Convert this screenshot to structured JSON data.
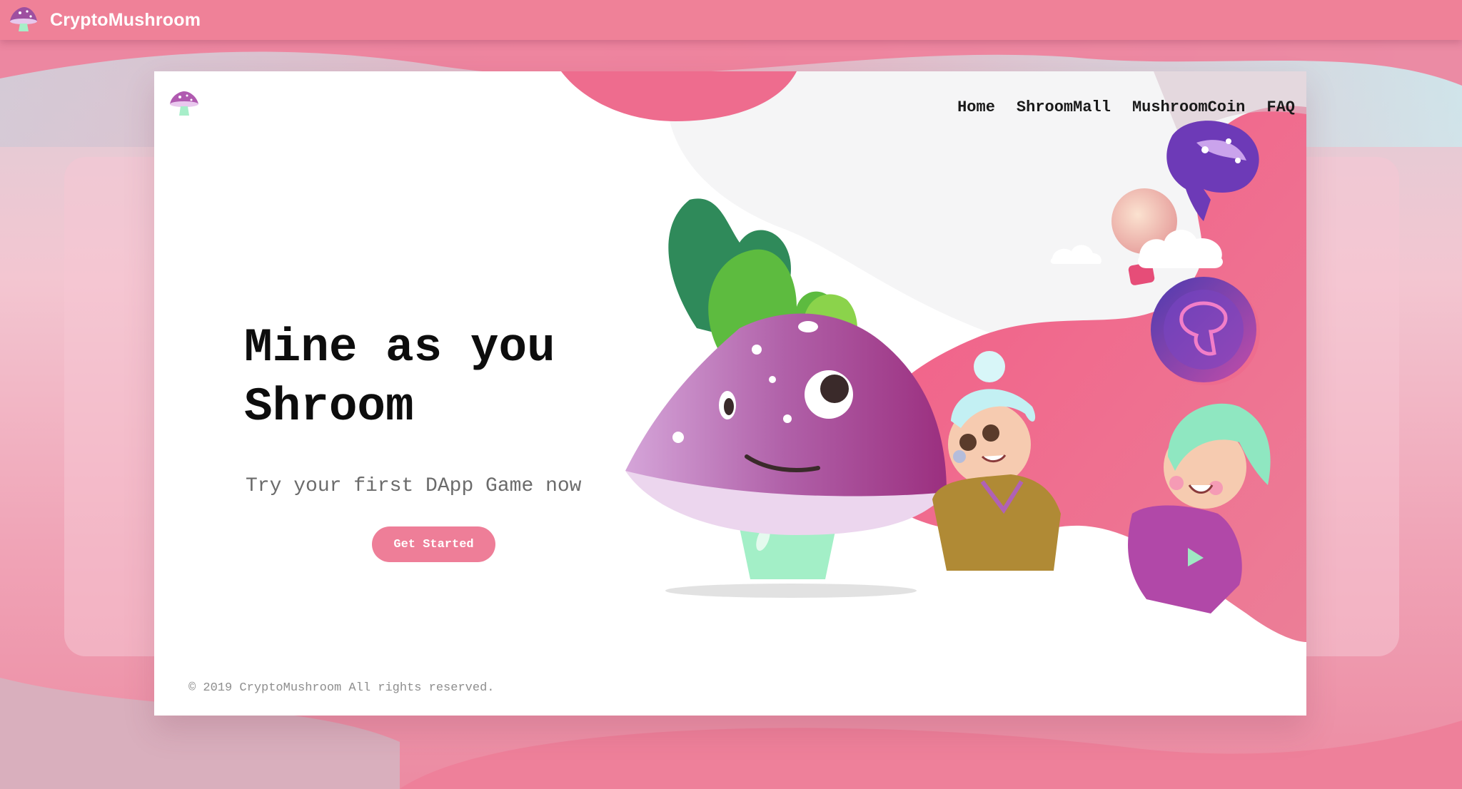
{
  "app": {
    "brand": "CryptoMushroom"
  },
  "nav": {
    "items": [
      "Home",
      "ShroomMall",
      "MushroomCoin",
      "FAQ"
    ]
  },
  "hero": {
    "title_line1": "Mine as you",
    "title_line2": "Shroom",
    "subtitle": "Try your first DApp Game now",
    "cta_label": "Get Started"
  },
  "footer": {
    "copyright": "© 2019 CryptoMushroom All rights reserved."
  },
  "colors": {
    "accent": "#ef8198",
    "cta": "#ee7e98",
    "mushroom_cap": "#b45fae",
    "mushroom_stem": "#9fe8c3",
    "leaf": "#4caf50"
  },
  "icons": [
    "mushroom-logo-icon",
    "purple-mushroom-icon",
    "lightbulb-icon",
    "cloud-icon",
    "mushroom-coin-icon"
  ]
}
